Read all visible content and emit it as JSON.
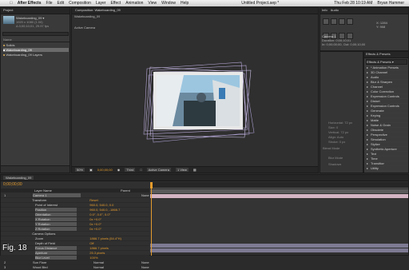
{
  "menubar": {
    "app": "After Effects",
    "items": [
      "File",
      "Edit",
      "Composition",
      "Layer",
      "Effect",
      "Animation",
      "View",
      "Window",
      "Help"
    ],
    "title": "Untitled Project.aep *",
    "clock": "Thu Feb 28 10:19 AM",
    "user": "Bryan Hammer"
  },
  "project": {
    "tab": "Project",
    "thumb_name": "Wakeboarding_09 ▾",
    "thumb_info1": "1920 x 1080 (1.00)",
    "thumb_info2": "Δ 0;00;10;01, 29.97 fps",
    "items_header": "Name",
    "items": [
      "Solids",
      "Wakeboarding_09",
      "Wakeboarding_09 Layers"
    ]
  },
  "composition": {
    "tab": "Composition: Wakeboarding_09",
    "subtab": "Wakeboarding_09",
    "camera_label": "Active Camera",
    "zoom": "50%",
    "time": "0;00;00;00",
    "resolution": "Third",
    "view": "Active Camera",
    "views": "1 View"
  },
  "info": {
    "tabs": [
      "Info",
      "Audio",
      "Preview",
      "Effects & Presets"
    ],
    "camera": "Camera 1",
    "duration": "Duration: 0;00;10;01",
    "in_out": "In: 0;00;00;00, Out: 0;00;10;00",
    "x": "X: 1284",
    "y": "Y: 908"
  },
  "effects": {
    "search": "Effects & Presets ▾",
    "items": [
      "* Animation Presets",
      "3D Channel",
      "Audio",
      "Blur & Sharpen",
      "Channel",
      "Color Correction",
      "Expression Controls",
      "Distort",
      "Expression Controls",
      "Generate",
      "Keying",
      "Matte",
      "Noise & Grain",
      "Obsolete",
      "Perspective",
      "Simulation",
      "Stylize",
      "Synthetic Aperture",
      "Text",
      "Time",
      "Transition",
      "Utility"
    ]
  },
  "paragraph": {
    "items": [
      "Horizontal: 72 px",
      "Size: 0",
      "Vertical: 72 px",
      "Align: Auto",
      "Stroke: 0 px",
      "Blend Mode",
      "Blur Mode",
      "Shadows"
    ]
  },
  "timeline": {
    "tab": "Wakeboarding_09",
    "timecode": "0;00;00;00",
    "layer_header": "Layer Name",
    "parent_header": "Parent",
    "layers": [
      {
        "num": "1",
        "name": "Camera 1",
        "value": "",
        "sub": false
      },
      {
        "num": "",
        "name": "Transform",
        "value": "Reset",
        "sub": true
      },
      {
        "num": "",
        "name": "Point of Interest",
        "value": "960.0, 540.0, 0.0",
        "sub": true
      },
      {
        "num": "",
        "name": "Position",
        "value": "960.0, 540.0, -1866.7",
        "sub": true
      },
      {
        "num": "",
        "name": "Orientation",
        "value": "0.0°, 0.0°, 0.0°",
        "sub": true
      },
      {
        "num": "",
        "name": "X Rotation",
        "value": "0x +0.0°",
        "sub": true
      },
      {
        "num": "",
        "name": "Y Rotation",
        "value": "0x +0.0°",
        "sub": true
      },
      {
        "num": "",
        "name": "Z Rotation",
        "value": "0x +0.0°",
        "sub": true
      },
      {
        "num": "",
        "name": "Camera Options",
        "value": "",
        "sub": true
      },
      {
        "num": "",
        "name": "Zoom",
        "value": "1866.7 pixels (54.4°H)",
        "sub": true
      },
      {
        "num": "",
        "name": "Depth of Field",
        "value": "Off",
        "sub": true
      },
      {
        "num": "",
        "name": "Focus Distance",
        "value": "1866.7 pixels",
        "sub": true
      },
      {
        "num": "",
        "name": "Aperture",
        "value": "25.3 pixels",
        "sub": true
      },
      {
        "num": "",
        "name": "Blur Level",
        "value": "100%",
        "sub": true
      },
      {
        "num": "2",
        "name": "Sun Flare",
        "value": "Normal",
        "sub": false
      },
      {
        "num": "3",
        "name": "Wood Bird",
        "value": "Normal",
        "sub": false
      }
    ],
    "parent_values": [
      "None",
      "None",
      "None"
    ]
  },
  "caption": "Fig. 18",
  "colors": {
    "accent": "#e39b2c",
    "track": "#7d7a93",
    "menubar": "#dcdcdc"
  }
}
